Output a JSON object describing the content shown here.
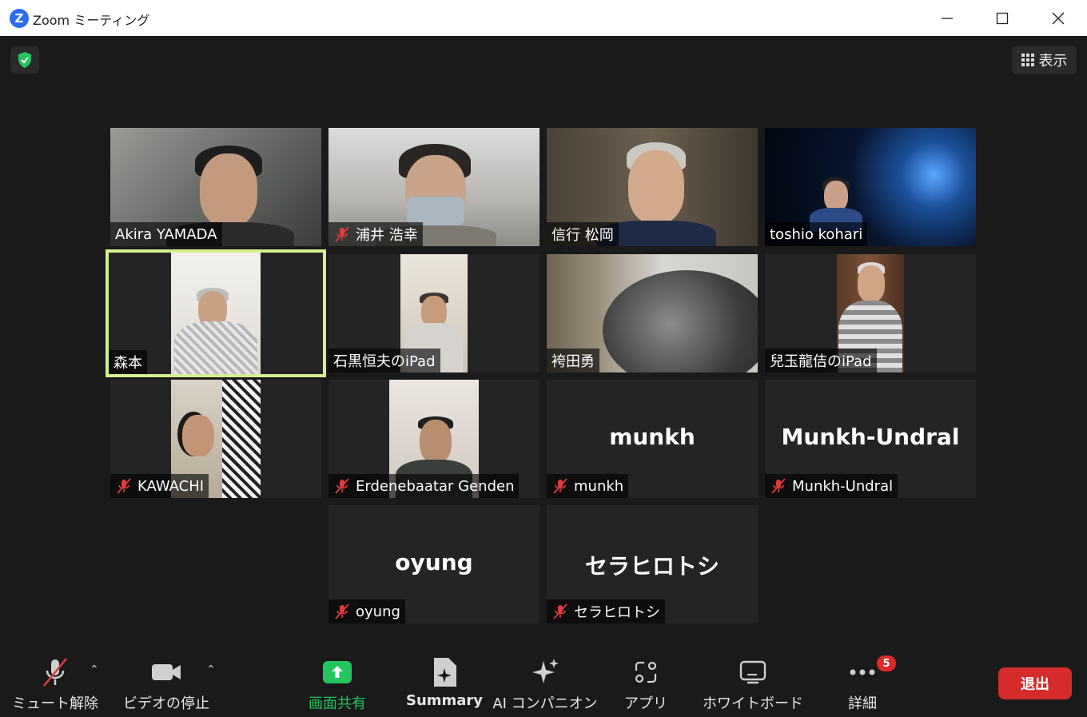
{
  "window": {
    "title": "Zoom ミーティング",
    "logo_letter": "Z",
    "minimize_icon": "minimize-icon",
    "maximize_icon": "maximize-icon",
    "close_icon": "close-icon"
  },
  "header": {
    "view_label": "表示",
    "shield_color": "#23c55e"
  },
  "participants": [
    {
      "name": "Akira YAMADA",
      "muted": false,
      "video": true
    },
    {
      "name": "浦井 浩幸",
      "muted": true,
      "video": true
    },
    {
      "name": "信行 松岡",
      "muted": false,
      "video": true
    },
    {
      "name": "toshio kohari",
      "muted": false,
      "video": true
    },
    {
      "name": "森本",
      "muted": false,
      "video": true,
      "active_speaker": true
    },
    {
      "name": "石黒恒夫のiPad",
      "muted": false,
      "video": true
    },
    {
      "name": "袴田勇",
      "muted": false,
      "video": true
    },
    {
      "name": "兒玉龍佶のiPad",
      "muted": false,
      "video": true
    },
    {
      "name": "KAWACHI",
      "muted": true,
      "video": true
    },
    {
      "name": "Erdenebaatar Genden",
      "muted": true,
      "video": true
    },
    {
      "name": "munkh",
      "muted": true,
      "video": false,
      "display": "munkh"
    },
    {
      "name": "Munkh-Undral",
      "muted": true,
      "video": false,
      "display": "Munkh-Undral"
    },
    {
      "name": "oyung",
      "muted": true,
      "video": false,
      "display": "oyung"
    },
    {
      "name": "セラヒロトシ",
      "muted": true,
      "video": false,
      "display": "セラヒロトシ"
    }
  ],
  "toolbar": {
    "unmute_label": "ミュート解除",
    "video_stop_label": "ビデオの停止",
    "share_label": "画面共有",
    "summary_label": "Summary",
    "ai_label": "AI コンパニオン",
    "apps_label": "アプリ",
    "whiteboard_label": "ホワイトボード",
    "more_label": "詳細",
    "more_badge": "5",
    "leave_label": "退出",
    "share_color": "#23c55e",
    "leave_color": "#d62b2b"
  }
}
